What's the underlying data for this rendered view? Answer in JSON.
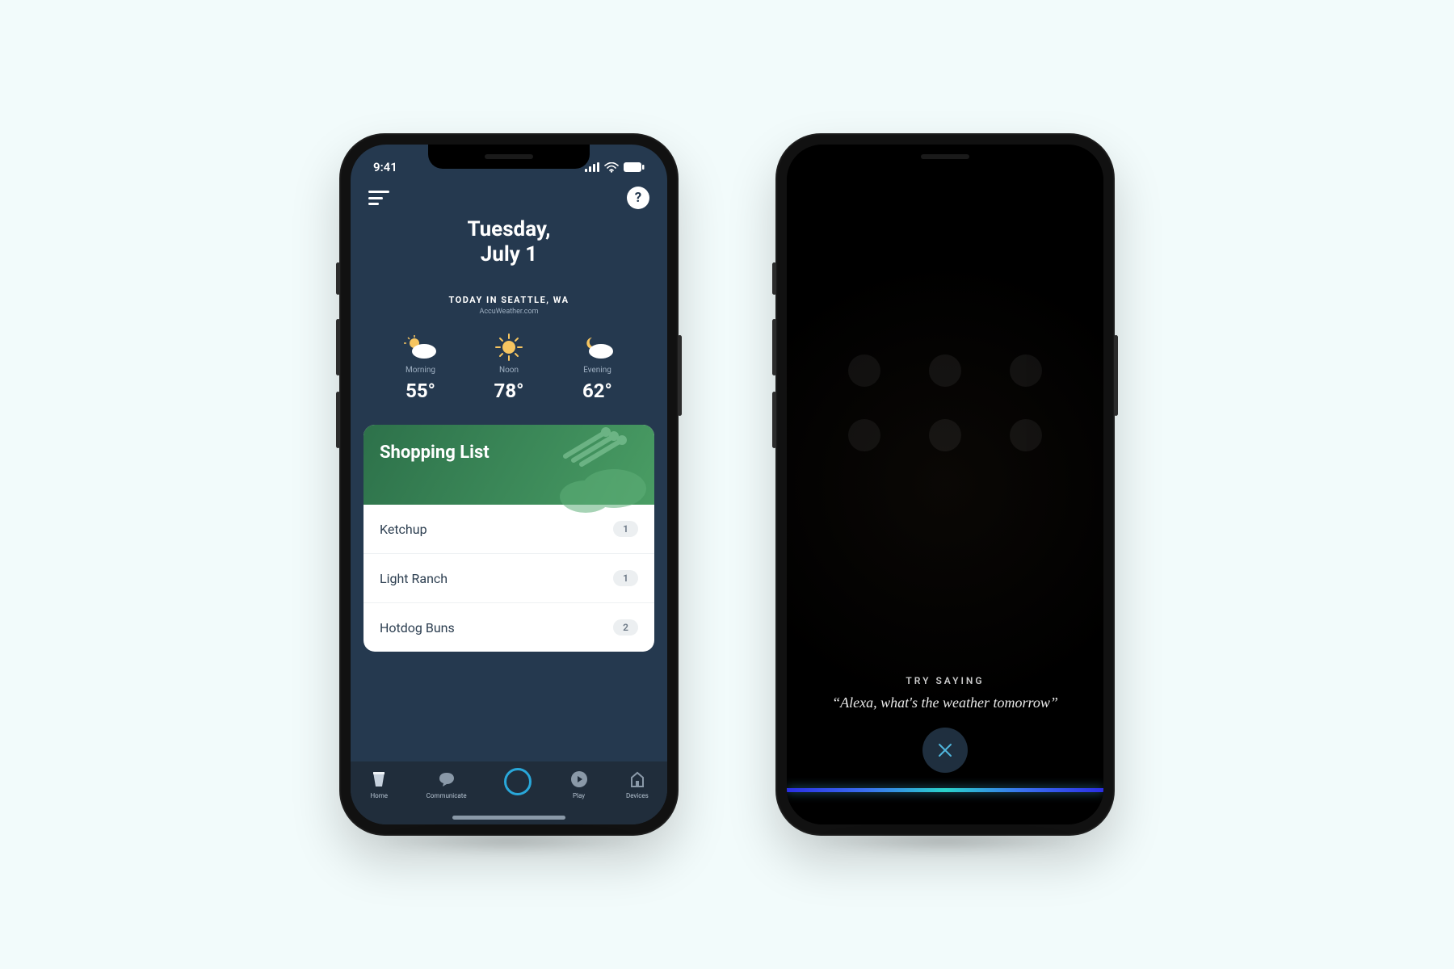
{
  "status": {
    "time": "9:41"
  },
  "header": {
    "date_line1": "Tuesday,",
    "date_line2": "July 1"
  },
  "weather": {
    "location_label": "TODAY IN SEATTLE, WA",
    "source": "AccuWeather.com",
    "periods": [
      {
        "label": "Morning",
        "temp": "55°",
        "icon": "partly-cloudy"
      },
      {
        "label": "Noon",
        "temp": "78°",
        "icon": "sunny"
      },
      {
        "label": "Evening",
        "temp": "62°",
        "icon": "night-cloudy"
      }
    ]
  },
  "shopping_list": {
    "title": "Shopping List",
    "items": [
      {
        "name": "Ketchup",
        "count": "1"
      },
      {
        "name": "Light Ranch",
        "count": "1"
      },
      {
        "name": "Hotdog Buns",
        "count": "2"
      }
    ]
  },
  "nav": {
    "home": "Home",
    "communicate": "Communicate",
    "play": "Play",
    "devices": "Devices"
  },
  "voice_prompt": {
    "try_label": "TRY SAYING",
    "phrase": "“Alexa, what's the weather tomorrow”"
  }
}
